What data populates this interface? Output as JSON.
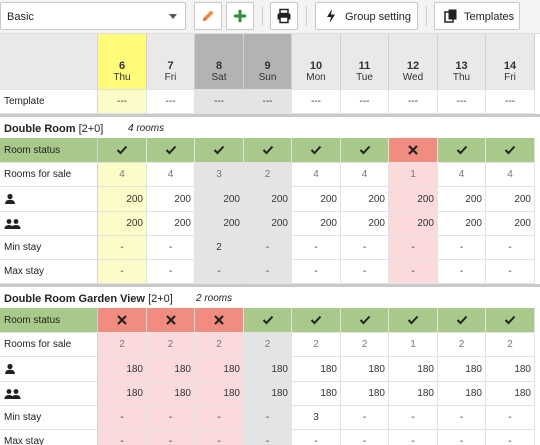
{
  "toolbar": {
    "selected_template": "Basic",
    "group_setting_label": "Group setting",
    "templates_label": "Templates"
  },
  "days": [
    {
      "date": "6",
      "day": "Thu",
      "kind": "today"
    },
    {
      "date": "7",
      "day": "Fri",
      "kind": "weekday"
    },
    {
      "date": "8",
      "day": "Sat",
      "kind": "weekend"
    },
    {
      "date": "9",
      "day": "Sun",
      "kind": "weekend"
    },
    {
      "date": "10",
      "day": "Mon",
      "kind": "weekday"
    },
    {
      "date": "11",
      "day": "Tue",
      "kind": "weekday"
    },
    {
      "date": "12",
      "day": "Wed",
      "kind": "weekday"
    },
    {
      "date": "13",
      "day": "Thu",
      "kind": "weekday"
    },
    {
      "date": "14",
      "day": "Fri",
      "kind": "weekday"
    }
  ],
  "template_row": {
    "label": "Template",
    "values": [
      "---",
      "---",
      "---",
      "---",
      "---",
      "---",
      "---",
      "---",
      "---"
    ]
  },
  "row_labels": {
    "status": "Room status",
    "sale": "Rooms for sale",
    "single_icon": "single-person-icon",
    "double_icon": "two-persons-icon",
    "min": "Min stay",
    "max": "Max stay"
  },
  "rooms": [
    {
      "name": "Double Room",
      "suffix": "[2+0]",
      "count": "4 rooms",
      "status": [
        "open",
        "open",
        "open",
        "open",
        "open",
        "open",
        "closed",
        "open",
        "open"
      ],
      "rooms_for_sale": [
        "4",
        "4",
        "3",
        "2",
        "4",
        "4",
        "1",
        "4",
        "4"
      ],
      "price_single": [
        "200",
        "200",
        "200",
        "200",
        "200",
        "200",
        "200",
        "200",
        "200"
      ],
      "price_double": [
        "200",
        "200",
        "200",
        "200",
        "200",
        "200",
        "200",
        "200",
        "200"
      ],
      "min_stay": [
        "-",
        "-",
        "2",
        "-",
        "-",
        "-",
        "-",
        "-",
        "-"
      ],
      "max_stay": [
        "-",
        "-",
        "-",
        "-",
        "-",
        "-",
        "-",
        "-",
        "-"
      ]
    },
    {
      "name": "Double Room Garden View",
      "suffix": "[2+0]",
      "count": "2 rooms",
      "status": [
        "closed",
        "closed",
        "closed",
        "open",
        "open",
        "open",
        "open",
        "open",
        "open"
      ],
      "rooms_for_sale": [
        "2",
        "2",
        "2",
        "2",
        "2",
        "2",
        "1",
        "2",
        "2"
      ],
      "price_single": [
        "180",
        "180",
        "180",
        "180",
        "180",
        "180",
        "180",
        "180",
        "180"
      ],
      "price_double": [
        "180",
        "180",
        "180",
        "180",
        "180",
        "180",
        "180",
        "180",
        "180"
      ],
      "min_stay": [
        "-",
        "-",
        "-",
        "-",
        "3",
        "-",
        "-",
        "-",
        "-"
      ],
      "max_stay": [
        "-",
        "-",
        "-",
        "-",
        "-",
        "-",
        "-",
        "-",
        "-"
      ]
    }
  ],
  "colors": {
    "today_header": "#fffb7a",
    "today_cell": "#fdfcc8",
    "weekend_header": "#b3b3b3",
    "weekend_cell": "#e4e4e4",
    "closed_cell": "#fadadb",
    "status_open": "#a8c98a",
    "status_closed": "#f08c80",
    "edit_icon": "#f0883c",
    "add_icon": "#2f8f2f"
  }
}
